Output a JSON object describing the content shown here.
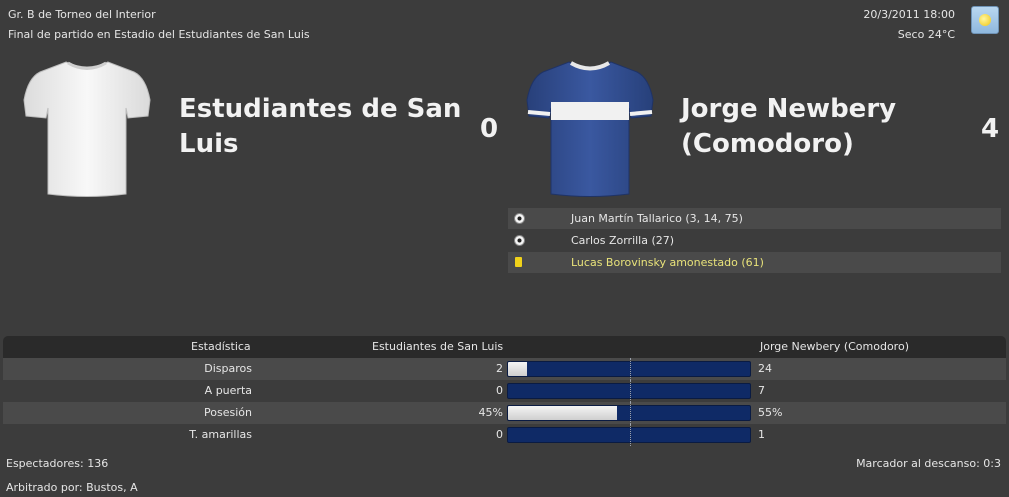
{
  "header": {
    "competition": "Gr. B de Torneo del Interior",
    "subtitle": "Final de partido en Estadio del Estudiantes de San Luis",
    "datetime": "20/3/2011 18:00",
    "weather": "Seco 24°C",
    "weather_icon": "sun-icon"
  },
  "home": {
    "name": "Estudiantes de San Luis",
    "score": "0",
    "shirt_color": "#f1f1f1"
  },
  "away": {
    "name": "Jorge Newbery (Comodoro)",
    "score": "4",
    "shirt_color": "#2f4b8f",
    "stripe_color": "#f1f1f1"
  },
  "events": [
    {
      "icon": "ball-icon",
      "text": "Juan Martín Tallarico (3, 14, 75)"
    },
    {
      "icon": "ball-icon",
      "text": "Carlos Zorrilla (27)"
    },
    {
      "icon": "yellow-card-icon",
      "text": "Lucas Borovinsky amonestado (61)"
    }
  ],
  "stats": {
    "header": {
      "label": "Estadística",
      "home": "Estudiantes de San Luis",
      "away": "Jorge Newbery (Comodoro)"
    },
    "rows": [
      {
        "label": "Disparos",
        "home": "2",
        "away": "24",
        "home_share": 0.077
      },
      {
        "label": "A puerta",
        "home": "0",
        "away": "7",
        "home_share": 0.0
      },
      {
        "label": "Posesión",
        "home": "45%",
        "away": "55%",
        "home_share": 0.45
      },
      {
        "label": "T. amarillas",
        "home": "0",
        "away": "1",
        "home_share": 0.0
      }
    ]
  },
  "footer": {
    "spectators": "Espectadores: 136",
    "halftime": "Marcador al descanso: 0:3",
    "referee": "Arbitrado por: Bustos, A"
  }
}
